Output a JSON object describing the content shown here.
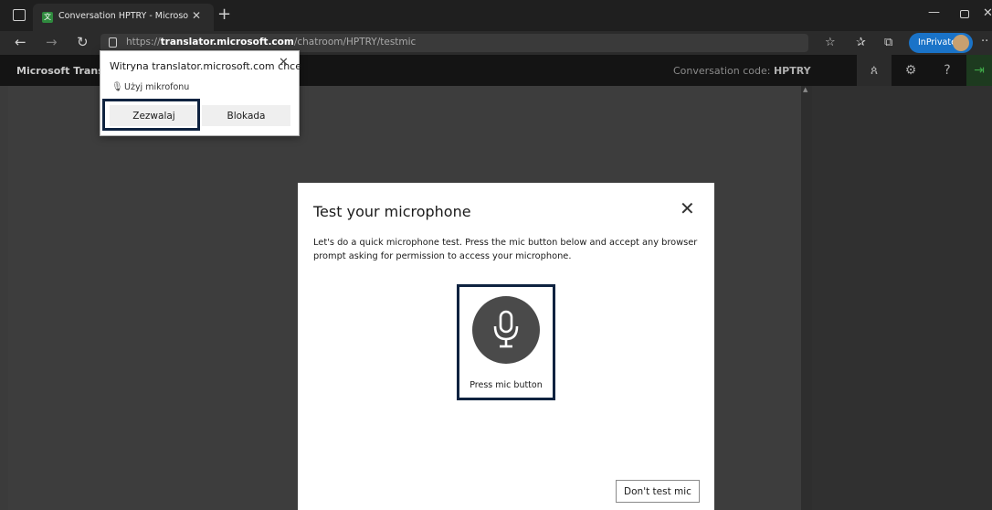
{
  "browser": {
    "tab_title": "Conversation HPTRY - Microsoft",
    "tab_favicon": "translator-icon",
    "url": {
      "prefix": "https://",
      "host": "translator.microsoft.com",
      "path": "/chatroom/HPTRY/testmic"
    },
    "inprivate_label": "InPrivate",
    "tab_close_glyph": "✕",
    "new_tab_glyph": "+",
    "accent_color": "#1a73c8"
  },
  "app": {
    "name": "Microsoft Translator",
    "conversation_code_label": "Conversation code: ",
    "conversation_code": "HPTRY",
    "header_buttons": [
      "participants-icon",
      "settings-icon",
      "help-icon",
      "exit-icon"
    ],
    "exit_color": "#3fa848"
  },
  "permission_popup": {
    "title": "Witryna translator.microsoft.com chce",
    "description": "Użyj mikrofonu",
    "allow_label": "Zezwalaj",
    "block_label": "Blokada"
  },
  "mic_test_dialog": {
    "title": "Test your microphone",
    "description": "Let's do a quick microphone test. Press the mic button below and accept any browser prompt asking for permission to access your microphone.",
    "mic_button_label": "Press mic button",
    "dont_test_label": "Don't test mic"
  },
  "highlight_color": "#0f2340"
}
